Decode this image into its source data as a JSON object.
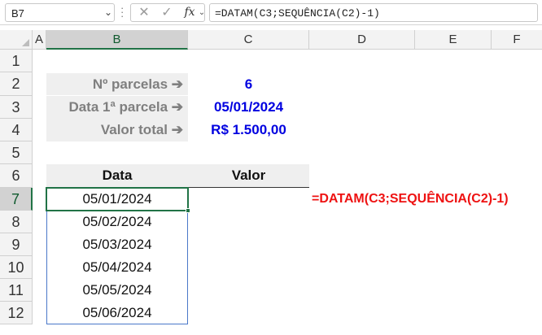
{
  "formula_bar": {
    "name_box": "B7",
    "formula": "=DATAM(C3;SEQUÊNCIA(C2)-1)",
    "icons": [
      "chevron-down-icon",
      "more-options-icon",
      "cancel-icon",
      "enter-icon",
      "insert-function-icon"
    ]
  },
  "sheet": {
    "columns": [
      "A",
      "B",
      "C",
      "D",
      "E",
      "F"
    ],
    "rows": [
      "1",
      "2",
      "3",
      "4",
      "5",
      "6",
      "7",
      "8",
      "9",
      "10",
      "11",
      "12"
    ],
    "selected_column": "B",
    "selected_row": "7",
    "params": [
      {
        "label": "Nº parcelas ➔",
        "value": "6"
      },
      {
        "label": "Data 1ª parcela ➔",
        "value": "05/01/2024"
      },
      {
        "label": "Valor total ➔",
        "value": "R$ 1.500,00"
      }
    ],
    "table_headers": {
      "data": "Data",
      "valor": "Valor"
    },
    "dates": [
      "05/01/2024",
      "05/02/2024",
      "05/03/2024",
      "05/04/2024",
      "05/05/2024",
      "05/06/2024"
    ],
    "formula_note": "=DATAM(C3;SEQUÊNCIA(C2)-1)"
  },
  "colors": {
    "selection_green": "#217346",
    "value_blue": "#0000e0",
    "formula_red": "#ee1111",
    "spill_border_blue": "#4a78c9"
  }
}
